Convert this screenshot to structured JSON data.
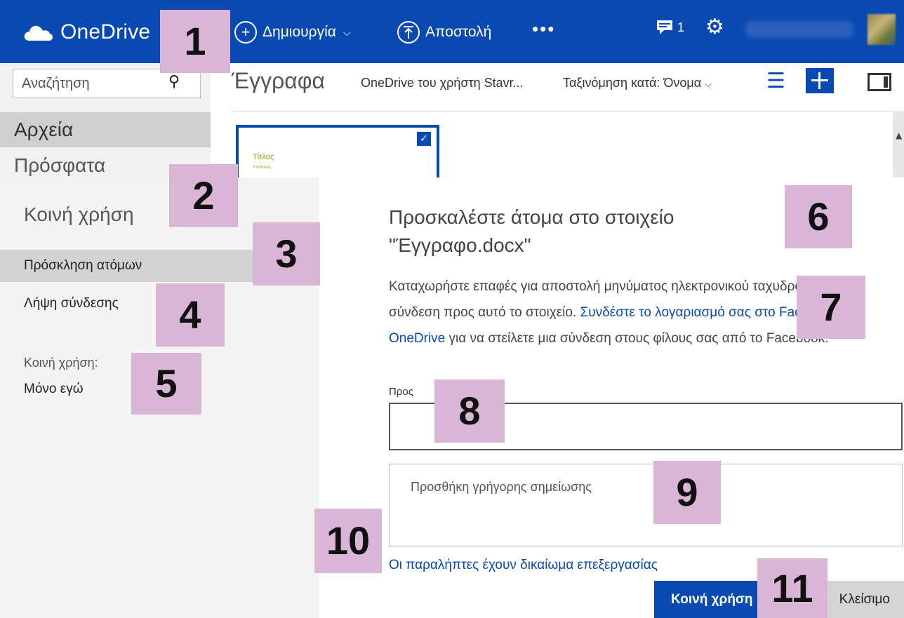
{
  "topbar": {
    "brand": "OneDrive",
    "create_label": "Δημιουργία",
    "upload_label": "Αποστολή",
    "more_label": "•••",
    "notifications_count": "1",
    "colors": {
      "bar": "#094ab2"
    }
  },
  "leftnav": {
    "search_placeholder": "Αναζήτηση",
    "files_label": "Αρχεία",
    "recent_label": "Πρόσφατα"
  },
  "main": {
    "title": "Έγγραφα",
    "breadcrumb": "OneDrive του χρήστη Stavr...",
    "sort_label": "Ταξινόμηση κατά: Όνομα",
    "tile": {
      "heading": "Τίτλος",
      "subheading": "Υπότιτλος"
    }
  },
  "share_dialog": {
    "title": "Κοινή χρήση",
    "option_invite": "Πρόσκληση ατόμων",
    "option_link": "Λήψη σύνδεσης",
    "shared_with_label": "Κοινή χρήση:",
    "shared_with_value": "Μόνο εγώ",
    "heading": "Προσκαλέστε άτομα στο στοιχείο \"Έγγραφο.docx\"",
    "description_text": "Καταχωρήστε επαφές για αποστολή μηνύματος ηλεκτρονικού ταχυδρομείου με σύνδεση προς αυτό το στοιχείο. ",
    "description_link": "Συνδέστε το λογαριασμό σας στο Facebook στο OneDrive",
    "description_tail": " για να στείλετε μια σύνδεση στους φίλους σας από το Facebook.",
    "to_label": "Προς",
    "to_value": "",
    "note_placeholder": "Προσθήκη γρήγορης σημείωσης",
    "permission_link": "Οι παραλήπτες έχουν δικαίωμα επεξεργασίας",
    "share_button": "Κοινή χρήση",
    "close_button": "Κλείσιμο"
  },
  "callouts": [
    "1",
    "2",
    "3",
    "4",
    "5",
    "6",
    "7",
    "8",
    "9",
    "10",
    "11"
  ]
}
